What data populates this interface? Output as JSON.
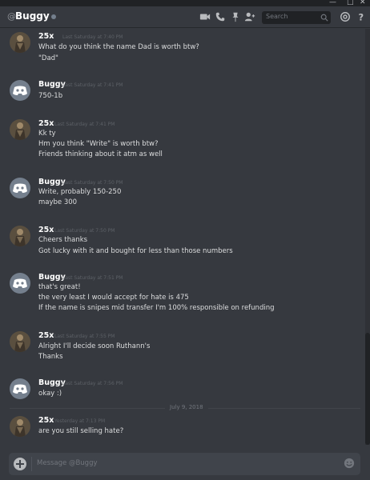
{
  "window": {
    "minimize": "—",
    "maximize": "□",
    "close": "✕"
  },
  "header": {
    "at_symbol": "@",
    "title": "Buggy",
    "search_placeholder": "Search",
    "icons": [
      "video-call-icon",
      "voice-call-icon",
      "pin-icon",
      "add-friend-icon",
      "search-icon",
      "mention-icon",
      "help-icon"
    ]
  },
  "messages": [
    {
      "author": "25x",
      "timestamp": "Last Saturday at 7:40 PM",
      "lines": [
        "What do you think the name Dad is worth btw?",
        "\"Dad\""
      ]
    },
    {
      "author": "Buggy",
      "timestamp": "Last Saturday at 7:41 PM",
      "lines": [
        "750-1b"
      ]
    },
    {
      "author": "25x",
      "timestamp": "Last Saturday at 7:41 PM",
      "lines": [
        "Kk ty",
        "Hm you think \"Write\" is worth btw?",
        "Friends thinking about it atm as well"
      ]
    },
    {
      "author": "Buggy",
      "timestamp": "Last Saturday at 7:50 PM",
      "lines": [
        "Write, probably 150-250",
        "maybe 300"
      ]
    },
    {
      "author": "25x",
      "timestamp": "Last Saturday at 7:50 PM",
      "lines": [
        "Cheers thanks",
        "Got lucky with it and bought for less than those numbers"
      ]
    },
    {
      "author": "Buggy",
      "timestamp": "Last Saturday at 7:51 PM",
      "lines": [
        "that's great!",
        "the very least I would accept for hate is 475",
        "If the name is snipes mid transfer I'm 100% responsible on refunding"
      ]
    },
    {
      "author": "25x",
      "timestamp": "Last Saturday at 7:55 PM",
      "lines": [
        "Alright I'll decide soon Ruthann's",
        "Thanks"
      ]
    },
    {
      "author": "Buggy",
      "timestamp": "Last Saturday at 7:56 PM",
      "lines": [
        "okay :)"
      ]
    },
    {
      "author": "25x",
      "timestamp": "Yesterday at 7:13 PM",
      "lines": [
        "are you still selling hate?"
      ]
    }
  ],
  "date_divider": "July 9, 2018",
  "composer": {
    "placeholder": "Message @Buggy"
  },
  "colors": {
    "background": "#36393f",
    "username": "#ffffff",
    "text": "#dcddde",
    "timestamp": "#5d6167",
    "status_offline": "#747f8d"
  }
}
